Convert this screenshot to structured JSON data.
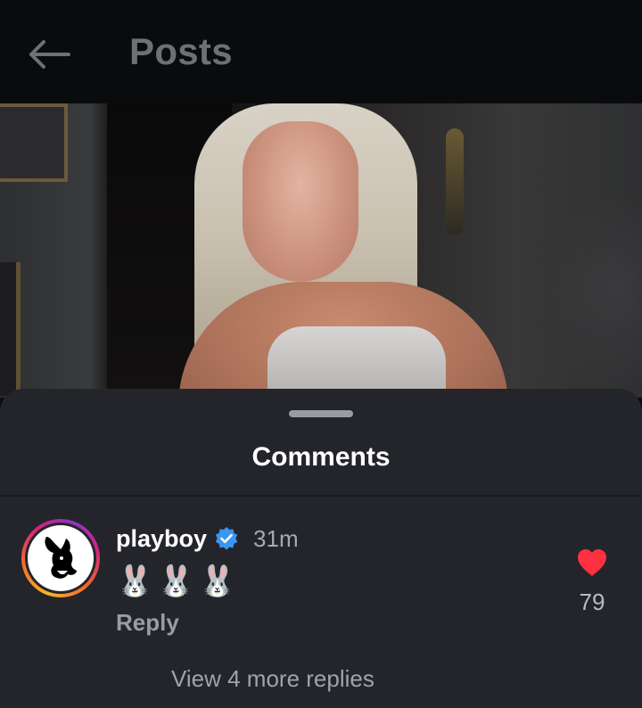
{
  "header": {
    "title": "Posts",
    "back_icon": "arrow-left-icon"
  },
  "post": {
    "image_subject": "photo"
  },
  "comments_sheet": {
    "title": "Comments",
    "comment": {
      "username": "playboy",
      "verified": true,
      "time_ago": "31m",
      "text": "🐰🐰🐰",
      "reply_label": "Reply",
      "like_count": "79",
      "liked": true,
      "like_color": "#ff3040"
    },
    "view_more_label": "View 4 more replies"
  },
  "colors": {
    "sheet_background": "#23252a",
    "verified_badge": "#3897f0",
    "story_ring_gradient": [
      "#f7b52b",
      "#f56b2a",
      "#d4227b",
      "#8f32c7"
    ]
  }
}
